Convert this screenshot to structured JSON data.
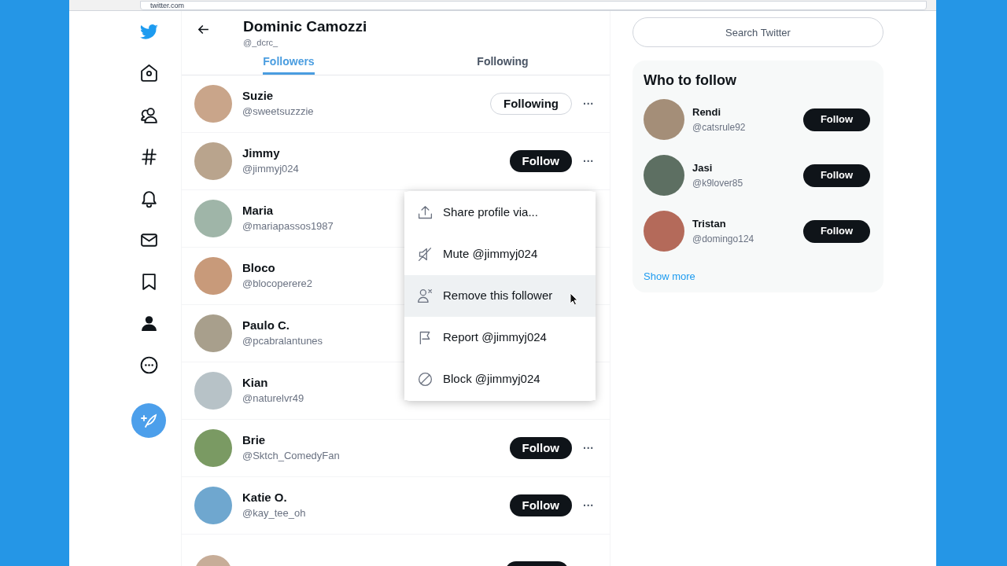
{
  "browser": {
    "address": "twitter.com"
  },
  "header": {
    "name": "Dominic Camozzi",
    "handle": "@_dcrc_"
  },
  "tabs": [
    {
      "label": "Followers",
      "selected": true
    },
    {
      "label": "Following",
      "selected": false
    }
  ],
  "followers": [
    {
      "kind": "user",
      "name": "Suzie",
      "handle": "@sweetsuzzzie",
      "button": "Following",
      "following": true,
      "more": "···"
    },
    {
      "kind": "user",
      "name": "Jimmy",
      "handle": "@jimmyj024",
      "button": "Follow",
      "following": false,
      "more": "···"
    },
    {
      "kind": "user",
      "name": "Maria",
      "handle": "@mariapassos1987"
    },
    {
      "kind": "user",
      "name": "Bloco",
      "handle": "@blocoperere2"
    },
    {
      "kind": "user",
      "name": "Paulo C.",
      "handle": "@pcabralantunes"
    },
    {
      "kind": "user",
      "name": "Kian",
      "handle": "@naturelvr49"
    },
    {
      "kind": "user",
      "name": "Brie",
      "handle": "@Sktch_ComedyFan",
      "button": "Follow",
      "following": false,
      "more": "···"
    },
    {
      "kind": "user",
      "name": "Katie O.",
      "handle": "@kay_tee_oh",
      "button": "Follow",
      "following": false,
      "more": "···"
    },
    {
      "kind": "cut"
    }
  ],
  "menu": [
    {
      "kind": "share",
      "label": "Share profile via...",
      "selected": false
    },
    {
      "kind": "mute",
      "label": "Mute @jimmyj024",
      "selected": false
    },
    {
      "kind": "remove",
      "label": "Remove this follower",
      "selected": true
    },
    {
      "kind": "report",
      "label": "Report @jimmyj024",
      "selected": false
    },
    {
      "kind": "block",
      "label": "Block @jimmyj024",
      "selected": false
    }
  ],
  "search": {
    "placeholder": "Search Twitter"
  },
  "who_to_follow": {
    "title": "Who to follow",
    "users": [
      {
        "name": "Rendi",
        "handle": "@catsrule92",
        "button": "Follow"
      },
      {
        "name": "Jasi",
        "handle": "@k9lover85",
        "button": "Follow"
      },
      {
        "name": "Tristan",
        "handle": "@domingo124",
        "button": "Follow"
      }
    ],
    "show_more": "Show more"
  }
}
